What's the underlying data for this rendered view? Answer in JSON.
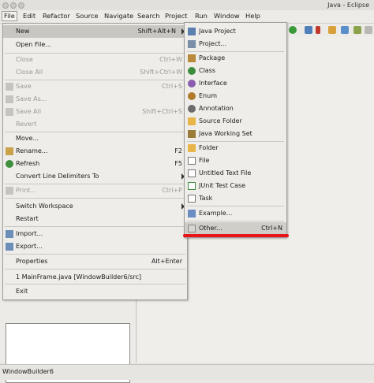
{
  "window": {
    "title": "Java - Eclipse"
  },
  "menubar": [
    "File",
    "Edit",
    "Refactor",
    "Source",
    "Navigate",
    "Search",
    "Project",
    "Run",
    "Window",
    "Help"
  ],
  "file_menu": {
    "items": [
      {
        "label": "New",
        "accel": "Shift+Alt+N",
        "icon": "none",
        "disabled": false,
        "submenu": true
      },
      {
        "label": "Open File...",
        "accel": "",
        "icon": "none",
        "disabled": false
      },
      {
        "label": "Close",
        "accel": "Ctrl+W",
        "icon": "none",
        "disabled": true
      },
      {
        "label": "Close All",
        "accel": "Shift+Ctrl+W",
        "icon": "none",
        "disabled": true
      },
      {
        "label": "Save",
        "accel": "Ctrl+S",
        "icon": "save-icon",
        "disabled": true
      },
      {
        "label": "Save As...",
        "accel": "",
        "icon": "save-as-icon",
        "disabled": true
      },
      {
        "label": "Save All",
        "accel": "Shift+Ctrl+S",
        "icon": "save-all-icon",
        "disabled": true
      },
      {
        "label": "Revert",
        "accel": "",
        "icon": "none",
        "disabled": true
      },
      {
        "label": "Move...",
        "accel": "",
        "icon": "none",
        "disabled": false
      },
      {
        "label": "Rename...",
        "accel": "F2",
        "icon": "rename-icon",
        "disabled": false
      },
      {
        "label": "Refresh",
        "accel": "F5",
        "icon": "refresh-icon",
        "disabled": false
      },
      {
        "label": "Convert Line Delimiters To",
        "accel": "",
        "icon": "none",
        "disabled": false,
        "submenu": true
      },
      {
        "label": "Print...",
        "accel": "Ctrl+P",
        "icon": "print-icon",
        "disabled": true
      },
      {
        "label": "Switch Workspace",
        "accel": "",
        "icon": "none",
        "disabled": false,
        "submenu": true
      },
      {
        "label": "Restart",
        "accel": "",
        "icon": "none",
        "disabled": false
      },
      {
        "label": "Import...",
        "accel": "",
        "icon": "import-icon",
        "disabled": false
      },
      {
        "label": "Export...",
        "accel": "",
        "icon": "export-icon",
        "disabled": false
      },
      {
        "label": "Properties",
        "accel": "Alt+Enter",
        "icon": "none",
        "disabled": false
      },
      {
        "label": "1 MainFrame.java  [WindowBuilder6/src]",
        "accel": "",
        "icon": "none",
        "disabled": false
      },
      {
        "label": "Exit",
        "accel": "",
        "icon": "none",
        "disabled": false
      }
    ]
  },
  "new_submenu": {
    "items": [
      {
        "label": "Java Project",
        "accel": "",
        "icon": "java-project-icon"
      },
      {
        "label": "Project...",
        "accel": "",
        "icon": "project-icon"
      },
      {
        "label": "Package",
        "accel": "",
        "icon": "package-icon"
      },
      {
        "label": "Class",
        "accel": "",
        "icon": "class-icon"
      },
      {
        "label": "Interface",
        "accel": "",
        "icon": "interface-icon"
      },
      {
        "label": "Enum",
        "accel": "",
        "icon": "enum-icon"
      },
      {
        "label": "Annotation",
        "accel": "",
        "icon": "annotation-icon"
      },
      {
        "label": "Source Folder",
        "accel": "",
        "icon": "source-folder-icon"
      },
      {
        "label": "Java Working Set",
        "accel": "",
        "icon": "working-set-icon"
      },
      {
        "label": "Folder",
        "accel": "",
        "icon": "folder-icon"
      },
      {
        "label": "File",
        "accel": "",
        "icon": "file-icon"
      },
      {
        "label": "Untitled Text File",
        "accel": "",
        "icon": "text-file-icon"
      },
      {
        "label": "JUnit Test Case",
        "accel": "",
        "icon": "junit-icon"
      },
      {
        "label": "Task",
        "accel": "",
        "icon": "task-icon"
      },
      {
        "label": "Example...",
        "accel": "",
        "icon": "example-icon"
      },
      {
        "label": "Other...",
        "accel": "Ctrl+N",
        "icon": "other-icon"
      }
    ]
  },
  "status": {
    "text": "WindowBuilder6"
  },
  "colors": {
    "highlight_underline": "#e8141a",
    "menu_bg": "#eeede9",
    "selected_bg": "#c7c6c1"
  }
}
